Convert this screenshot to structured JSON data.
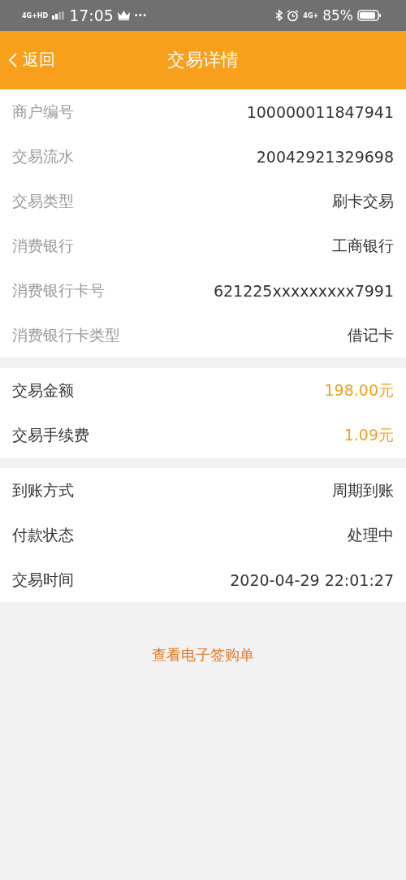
{
  "status_bar": {
    "network": "4G+HD",
    "time": "17:05",
    "more": "···",
    "network_2": "4G+",
    "battery": "85%"
  },
  "header": {
    "back": "返回",
    "title": "交易详情"
  },
  "sections": [
    {
      "kind": "muted",
      "rows": [
        {
          "label": "商户编号",
          "value": "100000011847941"
        },
        {
          "label": "交易流水",
          "value": "20042921329698"
        },
        {
          "label": "交易类型",
          "value": "刷卡交易"
        },
        {
          "label": "消费银行",
          "value": "工商银行"
        },
        {
          "label": "消费银行卡号",
          "value": "621225xxxxxxxxx7991"
        },
        {
          "label": "消费银行卡类型",
          "value": "借记卡"
        }
      ]
    },
    {
      "kind": "amount",
      "rows": [
        {
          "label": "交易金额",
          "value": "198.00元"
        },
        {
          "label": "交易手续费",
          "value": "1.09元"
        }
      ]
    },
    {
      "kind": "plain",
      "rows": [
        {
          "label": "到账方式",
          "value": "周期到账"
        },
        {
          "label": "付款状态",
          "value": "处理中"
        },
        {
          "label": "交易时间",
          "value": "2020-04-29 22:01:27"
        }
      ]
    }
  ],
  "link": "查看电子签购单"
}
